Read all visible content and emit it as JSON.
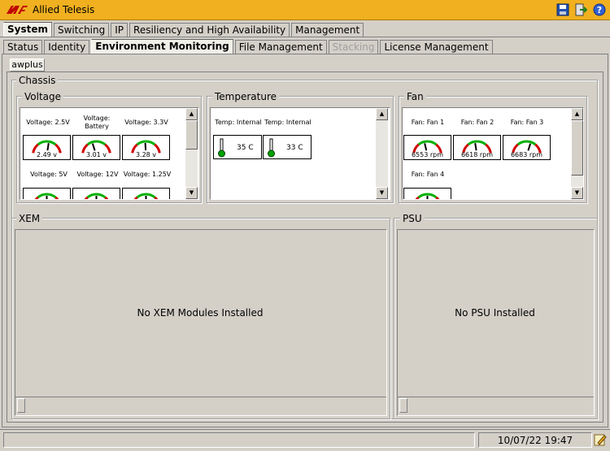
{
  "app": {
    "title": "Allied Telesis"
  },
  "main_tabs": [
    "System",
    "Switching",
    "IP",
    "Resiliency and High Availability",
    "Management"
  ],
  "sub_tabs": [
    "Status",
    "Identity",
    "Environment Monitoring",
    "File Management",
    "Stacking",
    "License Management"
  ],
  "device_tab": "awplus",
  "chassis": {
    "title": "Chassis",
    "voltage": {
      "title": "Voltage",
      "gauges": [
        {
          "label": "Voltage: 2.5V",
          "value": "2.49 v",
          "level": 0.55
        },
        {
          "label": "Voltage: Battery",
          "value": "3.01 v",
          "level": 0.4
        },
        {
          "label": "Voltage: 3.3V",
          "value": "3.28 v",
          "level": 0.48
        },
        {
          "label": "Voltage: 5V",
          "value": "",
          "level": 0.5
        },
        {
          "label": "Voltage: 12V",
          "value": "",
          "level": 0.5
        },
        {
          "label": "Voltage: 1.25V",
          "value": "",
          "level": 0.5
        }
      ]
    },
    "temperature": {
      "title": "Temperature",
      "sensors": [
        {
          "label": "Temp: Internal",
          "value": "35 C"
        },
        {
          "label": "Temp: Internal",
          "value": "33 C"
        }
      ]
    },
    "fan": {
      "title": "Fan",
      "gauges": [
        {
          "label": "Fan: Fan 1",
          "value": "6553 rpm",
          "level": 0.43
        },
        {
          "label": "Fan: Fan 2",
          "value": "6618 rpm",
          "level": 0.45
        },
        {
          "label": "Fan: Fan 3",
          "value": "6683 rpm",
          "level": 0.6
        },
        {
          "label": "Fan: Fan 4",
          "value": "",
          "level": 0.5
        }
      ]
    },
    "xem": {
      "title": "XEM",
      "message": "No XEM Modules Installed"
    },
    "psu": {
      "title": "PSU",
      "message": "No PSU Installed"
    }
  },
  "status_bar": {
    "datetime": "10/07/22 19:47"
  },
  "colors": {
    "title_bar": "#f0b020",
    "gauge_green": "#00b000",
    "gauge_red": "#d00000",
    "thermo_green": "#00a000"
  }
}
